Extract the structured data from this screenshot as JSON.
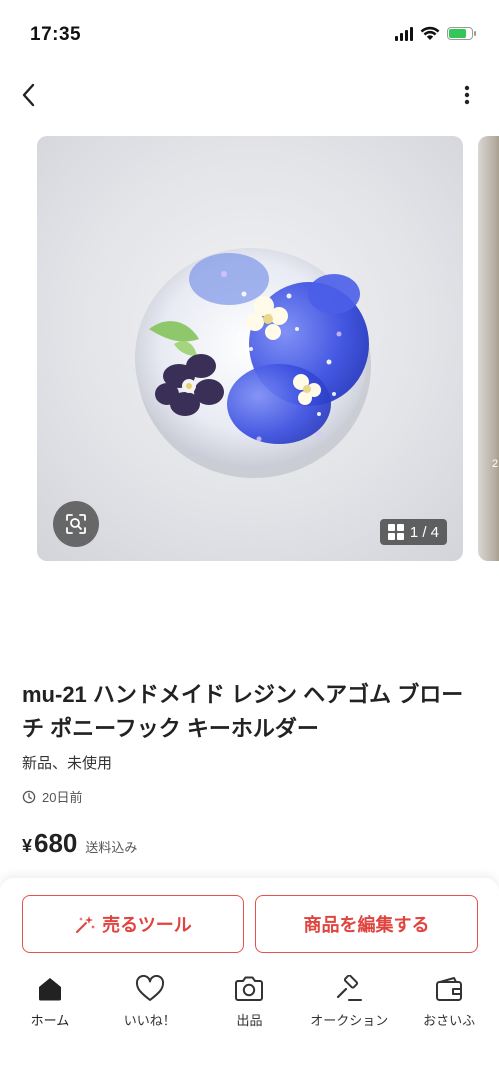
{
  "status_bar": {
    "time": "17:35"
  },
  "carousel": {
    "current": 1,
    "total": 4,
    "counter_text": "1 / 4",
    "next_peek_text": "2"
  },
  "product": {
    "title": "mu-21 ハンドメイド レジン ヘアゴム ブローチ ポニーフック キーホルダー",
    "condition": "新品、未使用",
    "posted": "20日前",
    "price_symbol": "¥",
    "price": "680",
    "price_note": "送料込み"
  },
  "actions": {
    "sell_tools_label": "売るツール",
    "edit_label": "商品を編集する"
  },
  "tabs": [
    {
      "label": "ホーム",
      "icon": "home-icon"
    },
    {
      "label": "いいね！",
      "icon": "heart-icon"
    },
    {
      "label": "出品",
      "icon": "camera-icon"
    },
    {
      "label": "オークション",
      "icon": "gavel-icon"
    },
    {
      "label": "おさいふ",
      "icon": "wallet-icon"
    }
  ],
  "colors": {
    "accent": "#e0443f",
    "battery": "#33c759"
  }
}
